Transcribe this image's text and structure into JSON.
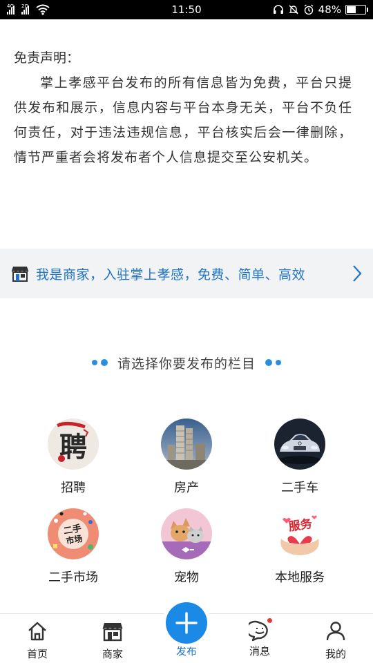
{
  "status_bar": {
    "net1": "4G",
    "net2": "2G",
    "time": "11:50",
    "battery": "48%",
    "battery_level": 0.48
  },
  "disclaimer": {
    "title": "免责声明：",
    "body": "掌上孝感平台发布的所有信息皆为免费，平台只提供发布和展示，信息内容与平台本身无关，平台不负任何责任，对于违法违规信息，平台核实后会一律删除，情节严重者会将发布者个人信息提交至公安机关。"
  },
  "merchant_banner": {
    "text": "我是商家，入驻掌上孝感，免费、简单、高效",
    "icon": "shop-icon"
  },
  "section": {
    "title": "请选择你要发布的栏目"
  },
  "categories": [
    {
      "label": "招聘",
      "icon": "recruit-icon",
      "thumb_text": "聘"
    },
    {
      "label": "房产",
      "icon": "real-estate-icon"
    },
    {
      "label": "二手车",
      "icon": "used-car-icon"
    },
    {
      "label": "二手市场",
      "icon": "secondhand-market-icon",
      "thumb_text": "二手市场"
    },
    {
      "label": "宠物",
      "icon": "pet-icon"
    },
    {
      "label": "本地服务",
      "icon": "local-service-icon",
      "thumb_text": "服务"
    }
  ],
  "nav": [
    {
      "label": "首页",
      "icon": "home-icon"
    },
    {
      "label": "商家",
      "icon": "shop-icon"
    },
    {
      "label": "发布",
      "icon": "plus-icon",
      "active": true
    },
    {
      "label": "消息",
      "icon": "message-icon",
      "badge": true
    },
    {
      "label": "我的",
      "icon": "profile-icon"
    }
  ],
  "colors": {
    "accent": "#1a8ae6",
    "link": "#1e73c8",
    "banner_bg": "#f2f3f5",
    "badge": "#e53935"
  }
}
